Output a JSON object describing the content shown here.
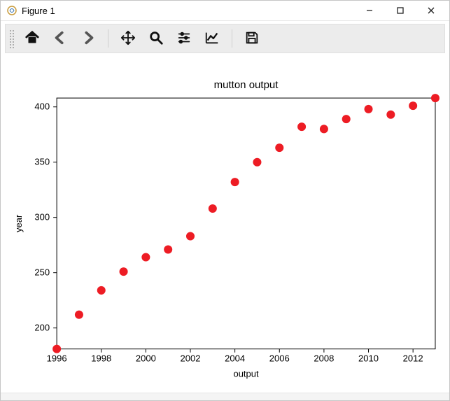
{
  "window": {
    "title": "Figure 1"
  },
  "toolbar": {
    "home": "home-icon",
    "back": "arrow-left-icon",
    "fwd": "arrow-right-icon",
    "pan": "move-icon",
    "zoom": "search-icon",
    "subplots": "sliders-icon",
    "edit": "line-chart-icon",
    "save": "save-icon"
  },
  "chart_data": {
    "type": "scatter",
    "title": "mutton output",
    "xlabel": "output",
    "ylabel": "year",
    "x": [
      1996,
      1997,
      1998,
      1999,
      2000,
      2001,
      2002,
      2003,
      2004,
      2005,
      2006,
      2007,
      2008,
      2009,
      2010,
      2011,
      2012,
      2013
    ],
    "y": [
      181,
      212,
      234,
      251,
      264,
      271,
      283,
      308,
      332,
      350,
      363,
      382,
      380,
      389,
      398,
      393,
      401,
      408
    ],
    "xticks": [
      1996,
      1998,
      2000,
      2002,
      2004,
      2006,
      2008,
      2010,
      2012
    ],
    "yticks": [
      200,
      250,
      300,
      350,
      400
    ],
    "xlim": [
      1996,
      2013
    ],
    "ylim": [
      181,
      408
    ],
    "marker_color": "#ed1c24"
  }
}
